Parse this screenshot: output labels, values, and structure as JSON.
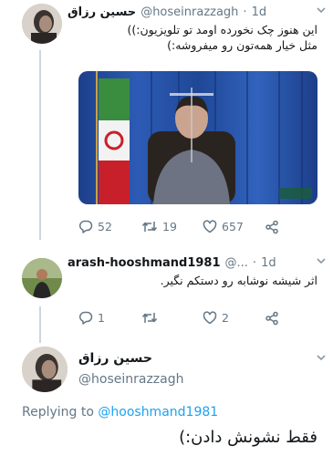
{
  "tweet1": {
    "display_name": "حسین رزاق",
    "handle": "@hoseinrazzagh",
    "separator": "·",
    "time": "1d",
    "text_line1": "این هنوز چک نخورده اومد تو تلویزیون:))",
    "text_line2": "مثل خیار همه‌تون رو میفروشه:)",
    "replies": "52",
    "retweets": "19",
    "likes": "657"
  },
  "tweet2": {
    "display_name": "arash-hooshmand1981",
    "handle": "@...",
    "separator": "·",
    "time": "1d",
    "text": "اثر شیشه نوشابه رو دستکم نگیر.",
    "replies": "1",
    "retweets": "",
    "likes": "2"
  },
  "tweet3": {
    "display_name": "حسین رزاق",
    "handle": "@hoseinrazzagh",
    "replying_prefix": "Replying to",
    "replying_handle": "@hooshmand1981",
    "text": "فقط نشونش دادن:)"
  },
  "colors": {
    "link": "#1da1f2",
    "muted": "#657786",
    "thread_line": "#ccd6dd"
  },
  "icons": [
    "chevron-down-icon",
    "reply-icon",
    "retweet-icon",
    "like-icon",
    "share-icon"
  ]
}
